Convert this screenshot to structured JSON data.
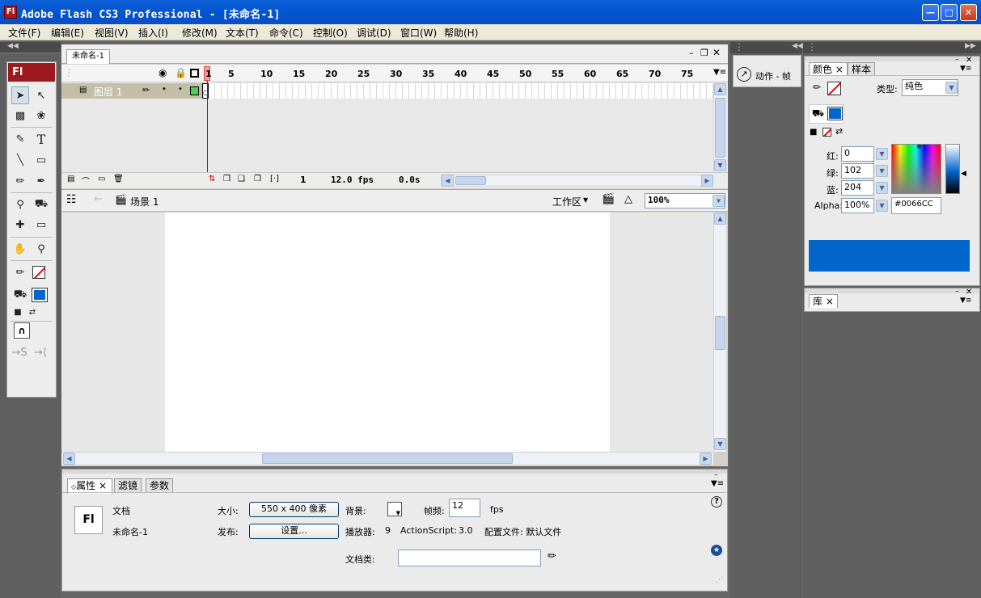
{
  "window": {
    "title": "Adobe Flash CS3 Professional - [未命名-1]",
    "icon_text": "Fl"
  },
  "menu": [
    "文件(F)",
    "编辑(E)",
    "视图(V)",
    "插入(I)",
    "修改(M)",
    "文本(T)",
    "命令(C)",
    "控制(O)",
    "调试(D)",
    "窗口(W)",
    "帮助(H)"
  ],
  "toolbox": {
    "logo": "Fl"
  },
  "document": {
    "tab": "未命名-1"
  },
  "timeline": {
    "frame_numbers": [
      "1",
      "5",
      "10",
      "15",
      "20",
      "25",
      "30",
      "35",
      "40",
      "45",
      "50",
      "55",
      "60",
      "65",
      "70",
      "75"
    ],
    "layer_name": "图层 1",
    "status": {
      "current_frame": "1",
      "fps": "12.0 fps",
      "time": "0.0s"
    }
  },
  "editbar": {
    "scene": "场景 1",
    "workspace": "工作区",
    "zoom": "100%"
  },
  "actions_panel": {
    "label": "动作 - 帧"
  },
  "color_panel": {
    "tabs": [
      "颜色",
      "样本"
    ],
    "type_label": "类型:",
    "type_value": "纯色",
    "red_label": "红:",
    "red": "0",
    "green_label": "绿:",
    "green": "102",
    "blue_label": "蓝:",
    "blue": "204",
    "alpha_label": "Alpha:",
    "alpha": "100%",
    "hex": "#0066CC",
    "swatch_color": "#0066CC"
  },
  "library_panel": {
    "tab": "库"
  },
  "properties": {
    "tabs": [
      "属性",
      "滤镜",
      "参数"
    ],
    "doc_label": "文档",
    "doc_name": "未命名-1",
    "size_label": "大小:",
    "size_value": "550 x 400 像素",
    "publish_label": "发布:",
    "settings_btn": "设置...",
    "bg_label": "背景:",
    "fps_label": "帧频:",
    "fps_value": "12",
    "fps_unit": "fps",
    "player_label": "播放器:",
    "player_value": "9",
    "as_label": "ActionScript:",
    "as_value": "3.0",
    "profile": "配置文件: 默认文件",
    "doc_class_label": "文档类:",
    "doc_class_value": ""
  }
}
